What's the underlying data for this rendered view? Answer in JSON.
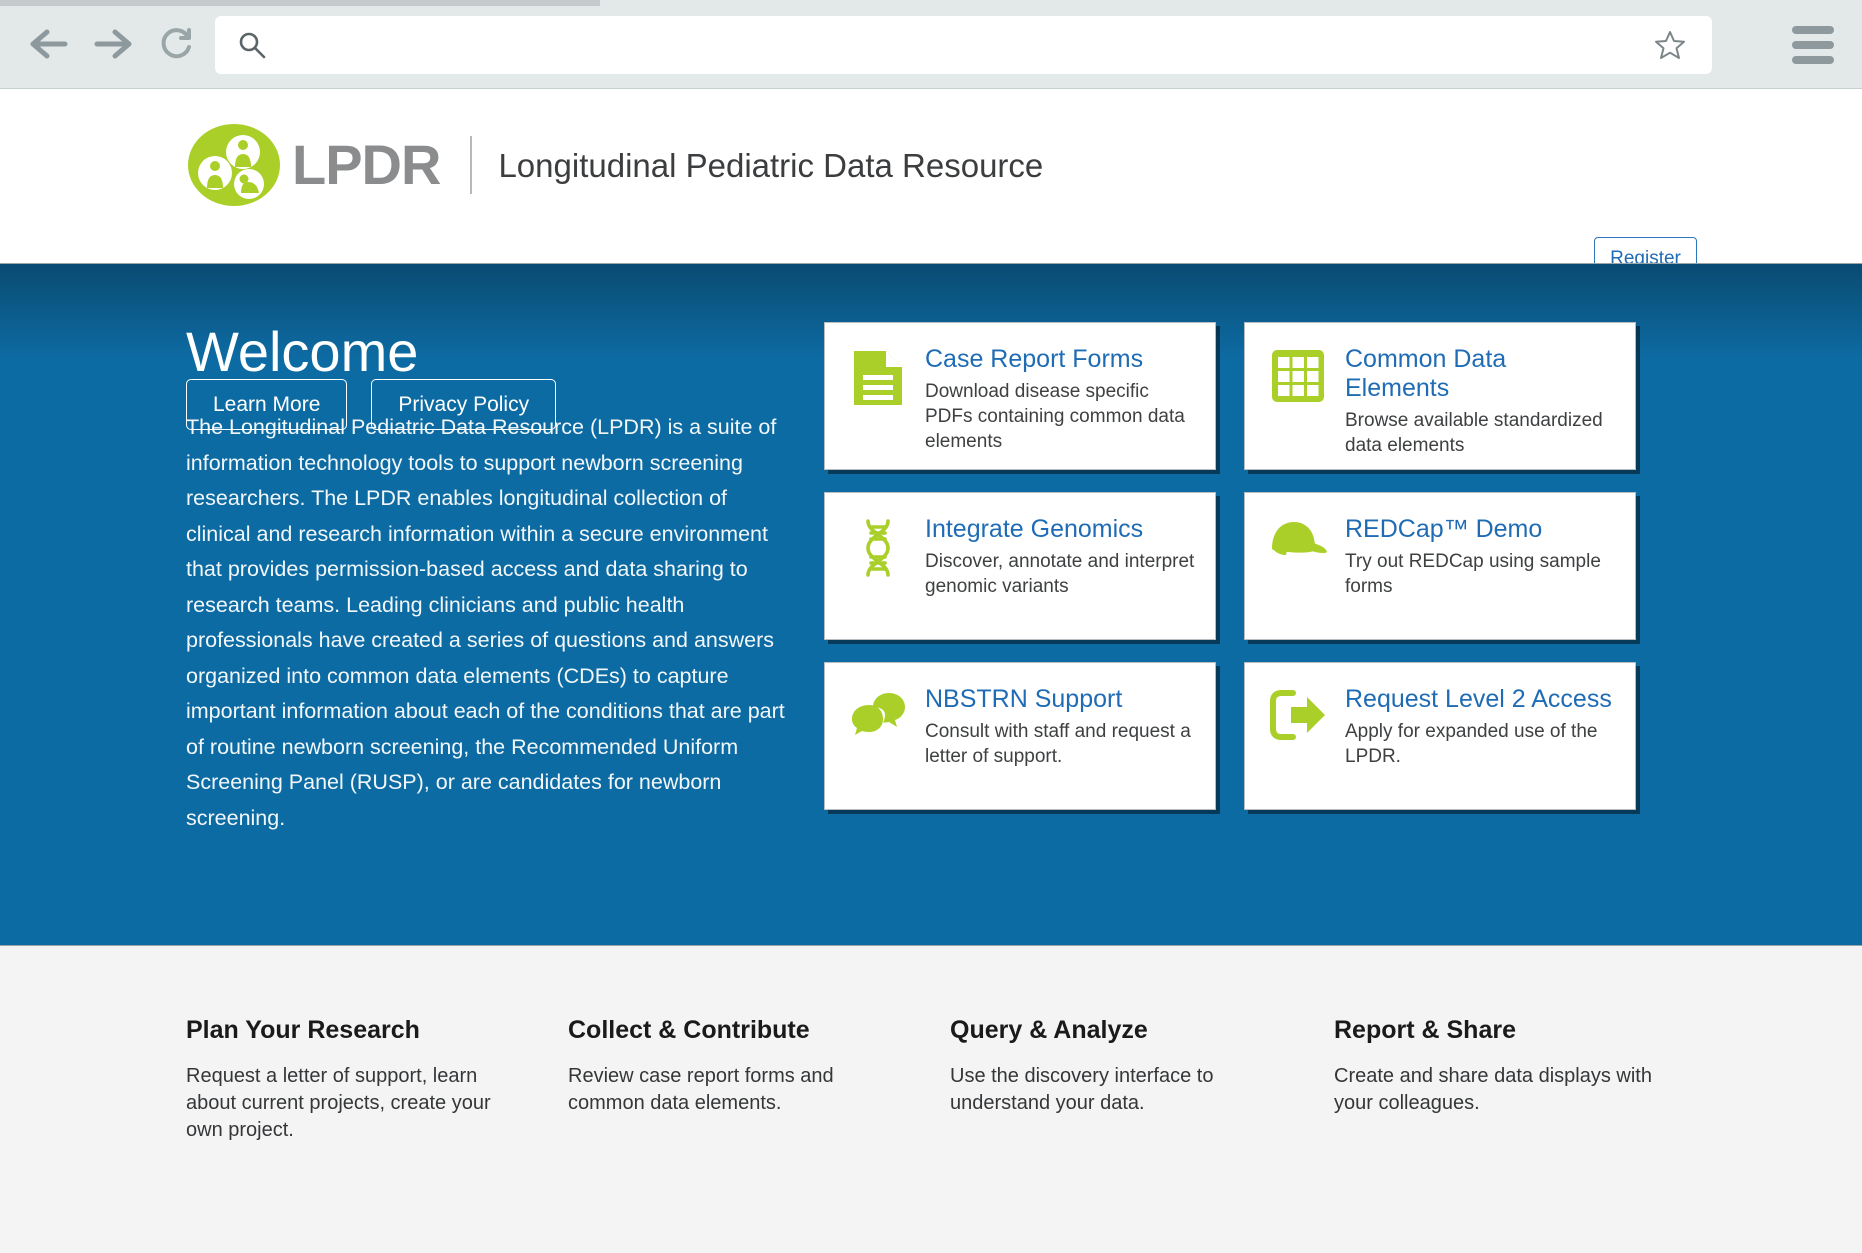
{
  "browser": {
    "back_icon": "arrow-left-icon",
    "forward_icon": "arrow-right-icon",
    "reload_icon": "reload-icon",
    "search_icon": "search-icon",
    "address_value": "",
    "address_placeholder": "",
    "bookmark_icon": "star-icon",
    "menu_icon": "hamburger-menu-icon"
  },
  "header": {
    "logo_icon": "lpdr-logo-icon",
    "abbr": "LPDR",
    "title": "Longitudinal Pediatric Data Resource",
    "register_label": "Register"
  },
  "hero": {
    "heading": "Welcome",
    "paragraph": "The Longitudinal Pediatric Data Resource (LPDR) is a suite of information technology tools to support newborn screening researchers. The LPDR enables longitudinal collection of clinical and research information within a secure environment that provides permission-based access and data sharing to research teams. Leading clinicians and public health professionals have created a series of questions and answers organized into common data elements (CDEs) to capture important information about each of the conditions that are part of routine newborn screening, the Recommended Uniform Screening Panel (RUSP), or are candidates for newborn screening.",
    "buttons": [
      {
        "label": "Learn More"
      },
      {
        "label": "Privacy Policy"
      }
    ],
    "tiles": [
      {
        "icon": "document-icon",
        "title": "Case Report Forms",
        "desc": "Download disease specific PDFs containing common data elements"
      },
      {
        "icon": "grid-table-icon",
        "title": "Common Data Elements",
        "desc": "Browse available standardized data elements"
      },
      {
        "icon": "dna-helix-icon",
        "title": "Integrate Genomics",
        "desc": "Discover, annotate and interpret genomic variants"
      },
      {
        "icon": "baseball-cap-icon",
        "title": "REDCap™ Demo",
        "desc": "Try out REDCap using sample forms"
      },
      {
        "icon": "speech-bubbles-icon",
        "title": "NBSTRN Support",
        "desc": "Consult with staff and request a letter of support."
      },
      {
        "icon": "exit-arrow-icon",
        "title": "Request Level 2 Access",
        "desc": "Apply for expanded use of the LPDR."
      }
    ]
  },
  "footer": {
    "columns": [
      {
        "title": "Plan Your Research",
        "desc": "Request a letter of support, learn about current projects, create your own project."
      },
      {
        "title": "Collect & Contribute",
        "desc": "Review case report forms and common data elements."
      },
      {
        "title": "Query & Analyze",
        "desc": "Use the discovery interface to understand your data."
      },
      {
        "title": "Report & Share",
        "desc": "Create and share data displays with your colleagues."
      }
    ]
  },
  "colors": {
    "hero_blue": "#0d6ba3",
    "brand_green": "#aacf28",
    "link_blue": "#1f6cb4",
    "chrome_grey": "#e3e8e9",
    "footer_grey": "#f4f4f4"
  }
}
